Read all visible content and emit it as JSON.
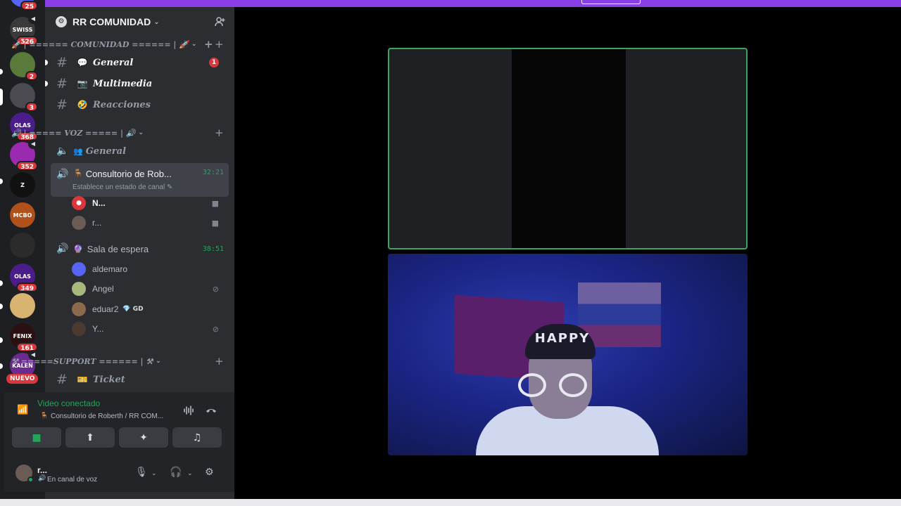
{
  "rail": {
    "top_badge": "25",
    "servers": [
      {
        "label": "SWISS",
        "color": "#3a3a3a",
        "badge": "526",
        "vol": true
      },
      {
        "label": "",
        "color": "#5a7a3a",
        "badge": "2",
        "vol": false
      },
      {
        "label": "",
        "color": "#4a4a50",
        "badge": "3",
        "vol": false
      },
      {
        "label": "OLAS",
        "color": "#4b1d8a",
        "badge": "368",
        "vol": false
      },
      {
        "label": "",
        "color": "#9a2ab0",
        "badge": "352",
        "vol": true
      },
      {
        "label": "Z",
        "color": "#111111",
        "badge": "",
        "vol": false
      },
      {
        "label": "MCBO",
        "color": "#b0501a",
        "badge": "",
        "vol": false
      },
      {
        "label": "",
        "color": "#2b2b2b",
        "badge": "",
        "vol": false
      },
      {
        "label": "OLAS",
        "color": "#4b1d8a",
        "badge": "349",
        "vol": false
      },
      {
        "label": "",
        "color": "#d9b470",
        "badge": "",
        "vol": false
      },
      {
        "label": "FENIX",
        "color": "#2a1010",
        "badge": "161",
        "vol": false
      },
      {
        "label": "KALEN",
        "color": "#6a2a90",
        "badge": "",
        "vol": true
      }
    ],
    "nuevo": "NUEVO"
  },
  "guild": {
    "name": "RR COMUNIDAD",
    "categories": [
      {
        "label": "🚀 | ====== COMUNIDAD ====== | 🚀"
      },
      {
        "label": "🔊 | ===== VOZ ===== | 🔊"
      },
      {
        "label": "⚒ =====SUPPORT ====== | ⚒"
      }
    ],
    "text_channels": [
      {
        "emoji": "💬",
        "name": "General",
        "mention": "1"
      },
      {
        "emoji": "📷",
        "name": "Multimedia",
        "mention": ""
      },
      {
        "emoji": "🤣",
        "name": "Reacciones",
        "mention": ""
      }
    ],
    "voice_general": {
      "emoji": "👥",
      "name": "General"
    },
    "active_voice": {
      "emoji": "🪑",
      "name": "Consultorio de Rob...",
      "timer": "32:21",
      "subtitle": "Establece un estado de canal"
    },
    "active_members": [
      {
        "name": "N...",
        "color": "#da373c"
      },
      {
        "name": "r...",
        "color": "#6a5c54"
      }
    ],
    "waiting_room": {
      "emoji": "🔮",
      "name": "Sala de espera",
      "timer": "38:51"
    },
    "waiting_members": [
      {
        "name": "aldemaro",
        "color": "#5865f2"
      },
      {
        "name": "Angel",
        "color": "#a8b87a"
      },
      {
        "name": "eduar2",
        "color": "#8a6a4a",
        "tag": "💎 GD"
      },
      {
        "name": "Y...",
        "color": "#4a3a30"
      }
    ],
    "support_channel": {
      "emoji": "🎫",
      "name": "Ticket"
    }
  },
  "voice_panel": {
    "status": "Video conectado",
    "channel": "Consultorio de Roberth / RR COM..."
  },
  "user_panel": {
    "name": "r...",
    "status": "En canal de voz"
  },
  "video": {
    "overlay_text": "HAPPY"
  },
  "colors": {
    "accent_purple": "#8a3ee6",
    "voice_green": "#23a55a",
    "mention_red": "#da373c"
  }
}
